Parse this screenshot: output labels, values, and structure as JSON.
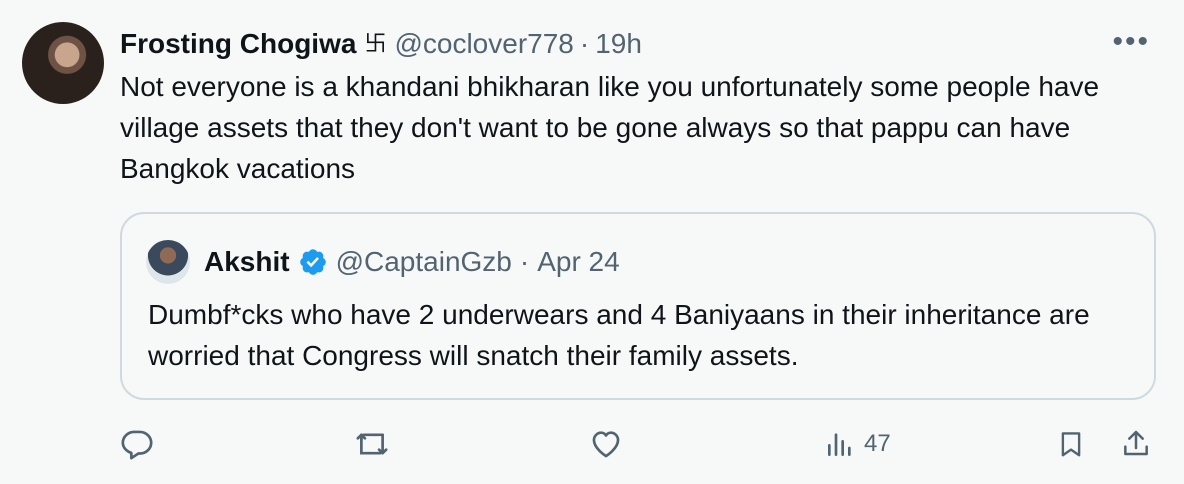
{
  "tweet": {
    "display_name": "Frosting Chogiwa",
    "name_emoji": "卐",
    "handle": "@coclover778",
    "separator": "·",
    "time": "19h",
    "more_label": "•••",
    "text": "Not everyone is a khandani bhikharan like you unfortunately some people have village assets that they don't want to be gone always so that pappu can have Bangkok vacations"
  },
  "quote": {
    "display_name": "Akshit",
    "handle": "@CaptainGzb",
    "separator": "·",
    "date": "Apr 24",
    "text": "Dumbf*cks who have 2 underwears and 4 Baniyaans in their inheritance are worried that Congress will snatch their family assets."
  },
  "actions": {
    "views_count": "47"
  },
  "colors": {
    "text": "#0f1419",
    "muted": "#536471",
    "border": "#cfd9de",
    "verified": "#1d9bf0",
    "background": "#f7f9f9"
  },
  "icons": [
    "reply-icon",
    "retweet-icon",
    "like-icon",
    "views-icon",
    "bookmark-icon",
    "share-icon",
    "verified-icon",
    "more-icon"
  ]
}
